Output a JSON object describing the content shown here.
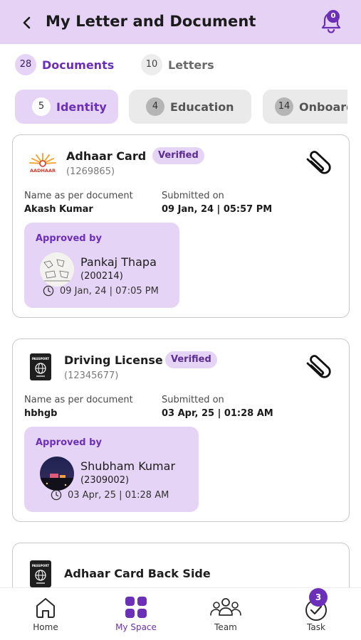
{
  "header": {
    "title": "My Letter and Document",
    "notification_count": "0"
  },
  "tabs": [
    {
      "count": "28",
      "label": "Documents",
      "active": true
    },
    {
      "count": "10",
      "label": "Letters",
      "active": false
    }
  ],
  "categories": [
    {
      "count": "5",
      "label": "Identity",
      "active": true
    },
    {
      "count": "4",
      "label": "Education",
      "active": false
    },
    {
      "count": "14",
      "label": "Onboarding",
      "active": false
    }
  ],
  "documents": [
    {
      "name": "Adhaar Card",
      "id": "(1269865)",
      "status": "Verified",
      "logo_text": "AADHAAR",
      "name_label": "Name as per document",
      "name_value": "Akash Kumar",
      "submitted_label": "Submitted on",
      "submitted_value": "09 Jan, 24 | 05:57 PM",
      "approved_label": "Approved by",
      "approver_name": "Pankaj Thapa",
      "approver_id": "(200214)",
      "approved_time": "09 Jan, 24 | 07:05 PM"
    },
    {
      "name": "Driving License",
      "id": "(12345677)",
      "status": "Verified",
      "logo_text": "PASSPORT",
      "name_label": "Name as per document",
      "name_value": "hbhgb",
      "submitted_label": "Submitted on",
      "submitted_value": "03 Apr, 25 | 01:28 AM",
      "approved_label": "Approved by",
      "approver_name": "Shubham Kumar",
      "approver_id": "(2309002)",
      "approved_time": "03 Apr, 25 | 01:28 AM"
    },
    {
      "name": "Adhaar Card Back Side",
      "logo_text": "PASSPORT"
    }
  ],
  "bottom_nav": [
    {
      "label": "Home",
      "icon": "home-icon"
    },
    {
      "label": "My Space",
      "icon": "grid-icon",
      "active": true
    },
    {
      "label": "Team",
      "icon": "team-icon"
    },
    {
      "label": "Task",
      "icon": "task-check-icon",
      "badge": "3"
    }
  ],
  "colors": {
    "accent": "#6b2fb8",
    "header_bg": "#e5d2f4",
    "pill_active_bg": "#e6d4f6",
    "pill_inactive_bg": "#eaeaea"
  }
}
